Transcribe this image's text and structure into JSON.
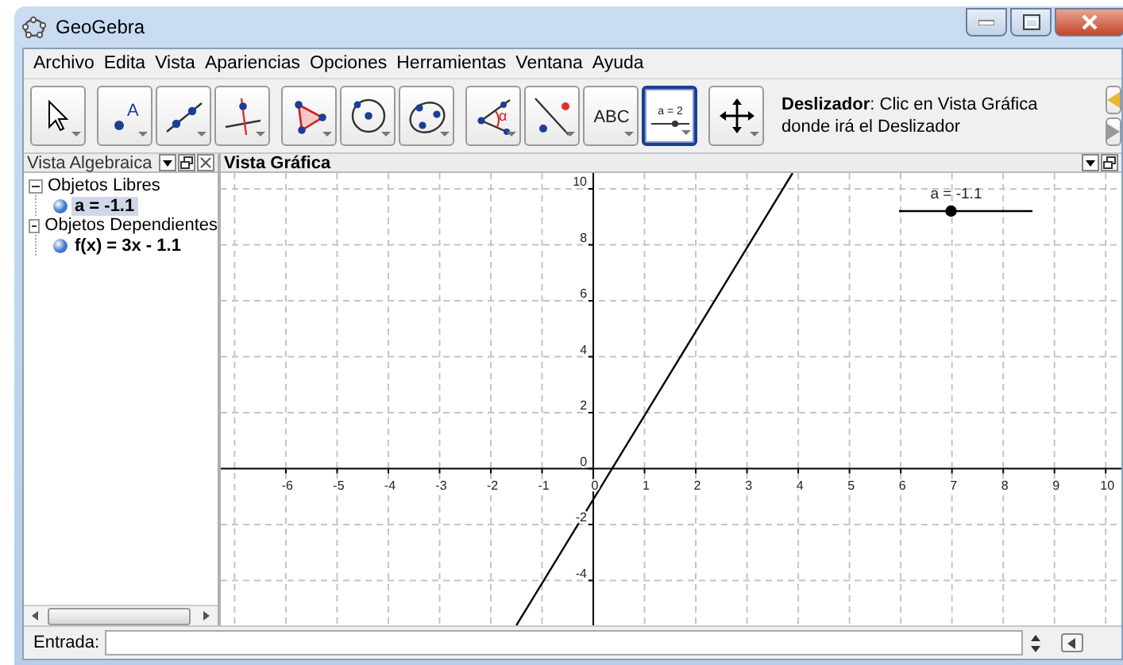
{
  "window": {
    "title": "GeoGebra"
  },
  "menu": [
    "Archivo",
    "Edita",
    "Vista",
    "Apariencias",
    "Opciones",
    "Herramientas",
    "Ventana",
    "Ayuda"
  ],
  "toolbar": {
    "tool_groups": [
      [
        {
          "kind": "move",
          "selected": false
        }
      ],
      [
        {
          "kind": "point",
          "label": "A",
          "selected": false
        },
        {
          "kind": "line",
          "selected": false
        },
        {
          "kind": "perpendicular",
          "selected": false
        }
      ],
      [
        {
          "kind": "polygon",
          "selected": false
        },
        {
          "kind": "circle",
          "selected": false
        },
        {
          "kind": "conic",
          "selected": false
        }
      ],
      [
        {
          "kind": "angle",
          "label": "α",
          "selected": false
        },
        {
          "kind": "reflect",
          "selected": false
        },
        {
          "kind": "text",
          "label": "ABC",
          "selected": false
        },
        {
          "kind": "slider",
          "label": "a = 2",
          "selected": true
        }
      ],
      [
        {
          "kind": "move_view",
          "selected": false
        }
      ]
    ],
    "help": "**Deslizador**: Clic en Vista Gráfica donde irá el Deslizador"
  },
  "algebra_view": {
    "title": "Vista Algebraica",
    "tree": [
      {
        "label": "Objetos Libres",
        "expanded": true,
        "children": [
          {
            "label": "a = -1.1",
            "selected": true,
            "shown": true
          }
        ]
      },
      {
        "label": "Objetos Dependientes",
        "expanded": true,
        "children": [
          {
            "label": "f(x) = 3x - 1.1",
            "selected": false,
            "shown": true
          }
        ]
      }
    ]
  },
  "graphics_view": {
    "title": "Vista Gráfica",
    "slider": {
      "label": "a = -1.1",
      "level": 0.39
    },
    "chart_data": {
      "type": "line",
      "x": [
        -1.5,
        3.89
      ],
      "series": [
        {
          "color": "#000000",
          "values": [
            -5.6,
            10.57
          ]
        }
      ],
      "xlim": [
        -7.27,
        10.4
      ],
      "ylim": [
        -5.6,
        10.57
      ],
      "xticks": [
        -6,
        -5,
        -4,
        -3,
        -2,
        -1,
        0,
        1,
        2,
        3,
        4,
        5,
        6,
        7,
        8,
        9,
        10
      ],
      "yticks": [
        -4,
        -2,
        0,
        2,
        4,
        6,
        8,
        10
      ],
      "grid": true
    }
  },
  "input_bar": {
    "label": "Entrada:"
  }
}
